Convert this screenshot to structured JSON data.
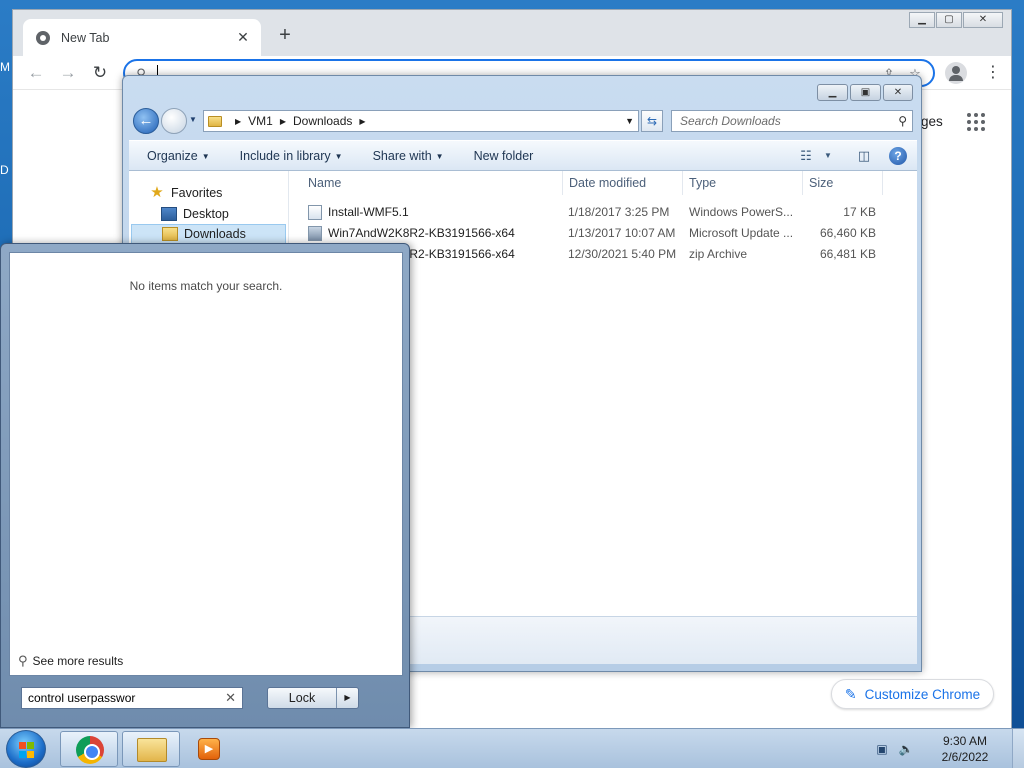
{
  "desktop": {
    "edge_text_1": "M",
    "edge_text_2": "D"
  },
  "chrome": {
    "tab_title": "New Tab",
    "tab_close": "✕",
    "new_tab": "+",
    "omnibox_value": "",
    "images_link": "ges",
    "customize_label": "Customize Chrome",
    "colors": {
      "accent": "#1a73e8",
      "titlebar": "#dfe3e8"
    }
  },
  "explorer": {
    "breadcrumb": [
      "VM1",
      "Downloads"
    ],
    "search_placeholder": "Search Downloads",
    "commands": [
      "Organize",
      "Include in library",
      "Share with",
      "New folder"
    ],
    "nav": {
      "favorites": "Favorites",
      "desktop": "Desktop",
      "downloads": "Downloads"
    },
    "columns": [
      "Name",
      "Date modified",
      "Type",
      "Size"
    ],
    "files": [
      {
        "name": "Install-WMF5.1",
        "date": "1/18/2017 3:25 PM",
        "type": "Windows PowerS...",
        "size": "17 KB"
      },
      {
        "name": "Win7AndW2K8R2-KB3191566-x64",
        "date": "1/13/2017 10:07 AM",
        "type": "Microsoft Update ...",
        "size": "66,460 KB"
      },
      {
        "name": "Win7AndW2K8R2-KB3191566-x64",
        "date": "12/30/2021 5:40 PM",
        "type": "zip Archive",
        "size": "66,481 KB"
      }
    ]
  },
  "startmenu": {
    "no_items": "No items match your search.",
    "see_more": "See more results",
    "search_value": "control userpasswor",
    "clear": "✕",
    "lock_label": "Lock"
  },
  "taskbar": {
    "time": "9:30 AM",
    "date": "2/6/2022"
  }
}
